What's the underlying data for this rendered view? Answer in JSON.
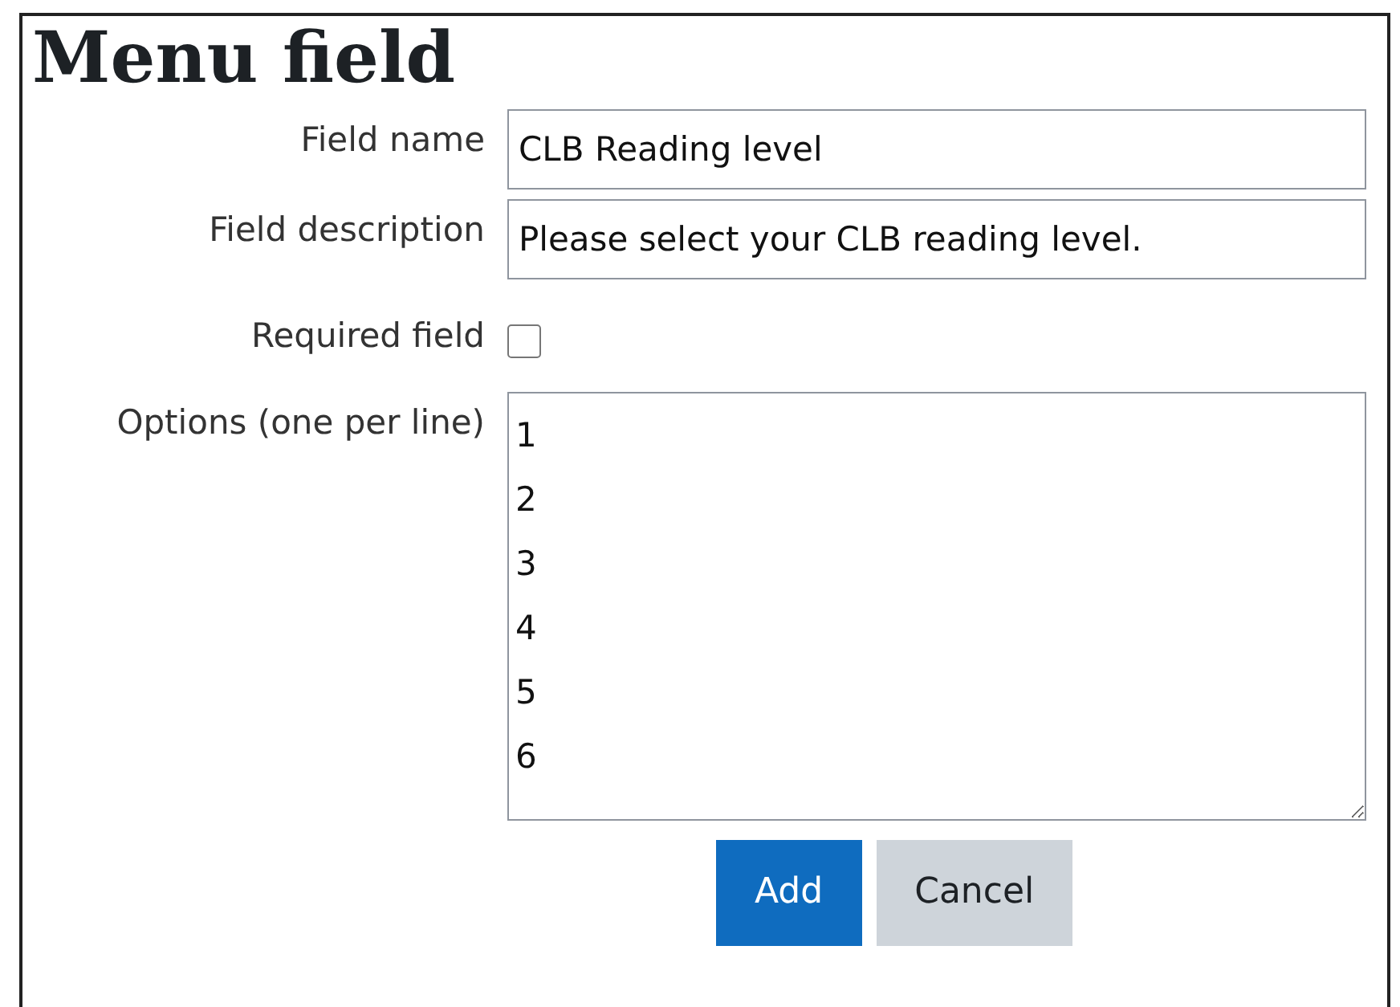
{
  "heading": "Menu field",
  "fields": [
    {
      "kind": "text",
      "label": "Field name",
      "value": "CLB Reading level"
    },
    {
      "kind": "text",
      "label": "Field description",
      "value": "Please select your CLB reading level."
    },
    {
      "kind": "checkbox",
      "label": "Required field",
      "checked": false
    },
    {
      "kind": "textarea",
      "label": "Options (one per line)",
      "lines": [
        "1",
        "2",
        "3",
        "4",
        "5",
        "6"
      ]
    }
  ],
  "buttons": [
    {
      "kind": "primary",
      "label": "Add"
    },
    {
      "kind": "secondary",
      "label": "Cancel"
    }
  ]
}
